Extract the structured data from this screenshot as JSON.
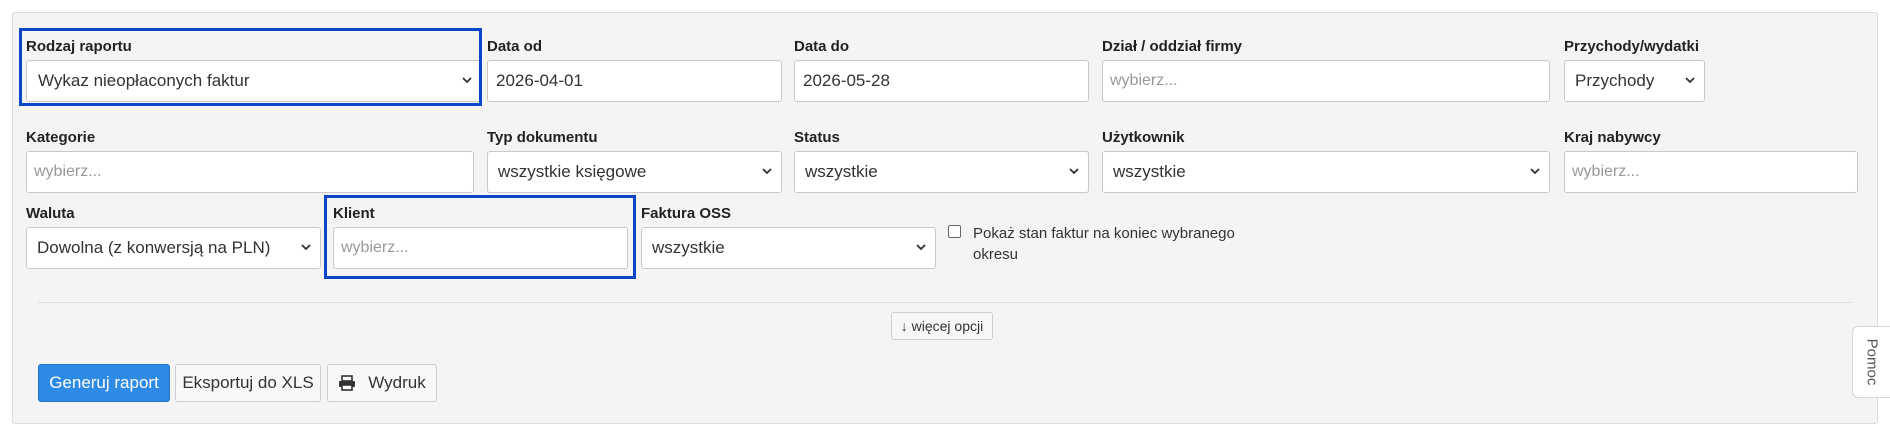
{
  "form": {
    "report_type": {
      "label": "Rodzaj raportu",
      "value": "Wykaz nieopłaconych faktur"
    },
    "date_from": {
      "label": "Data od",
      "value": "2026-04-01"
    },
    "date_to": {
      "label": "Data do",
      "value": "2026-05-28"
    },
    "department": {
      "label": "Dział / oddział firmy",
      "placeholder": "wybierz..."
    },
    "income_expense": {
      "label": "Przychody/wydatki",
      "value": "Przychody"
    },
    "categories": {
      "label": "Kategorie",
      "placeholder": "wybierz..."
    },
    "document_type": {
      "label": "Typ dokumentu",
      "value": "wszystkie księgowe"
    },
    "status": {
      "label": "Status",
      "value": "wszystkie"
    },
    "user": {
      "label": "Użytkownik",
      "value": "wszystkie"
    },
    "buyer_country": {
      "label": "Kraj nabywcy",
      "placeholder": "wybierz..."
    },
    "currency": {
      "label": "Waluta",
      "value": "Dowolna (z konwersją na PLN)"
    },
    "client": {
      "label": "Klient",
      "placeholder": "wybierz..."
    },
    "oss_invoice": {
      "label": "Faktura OSS",
      "value": "wszystkie"
    },
    "end_of_period_checkbox": {
      "label": "Pokaż stan faktur na koniec wybranego okresu",
      "checked": false
    }
  },
  "more_options_label": "↓ więcej opcji",
  "actions": {
    "generate": "Generuj raport",
    "export_xls": "Eksportuj do XLS",
    "print": "Wydruk"
  },
  "help_tab": "Pomoc",
  "colors": {
    "highlight_border": "#0a47c7",
    "primary_button": "#2d8be6",
    "panel_background": "#f4f4f4"
  },
  "icons": {
    "select_arrow": "chevron-down-icon",
    "print": "printer-icon"
  }
}
